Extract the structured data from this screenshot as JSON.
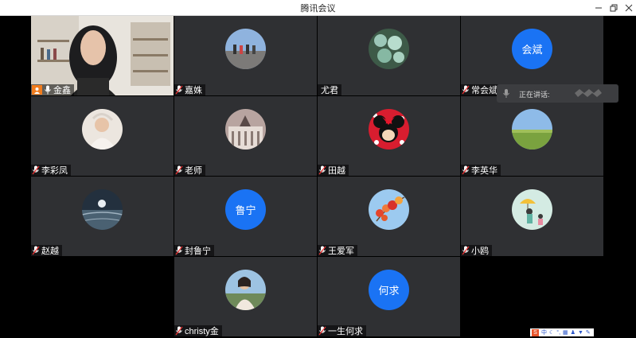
{
  "window": {
    "title": "腾讯会议",
    "minimize_icon": "minimize-icon",
    "restore_icon": "restore-icon",
    "close_icon": "close-icon"
  },
  "speaking": {
    "label": "正在讲话:"
  },
  "participants": [
    {
      "name": "金鑫",
      "avatar": "camera-video",
      "host": true
    },
    {
      "name": "嘉姝",
      "avatar": "photo-group-outdoor"
    },
    {
      "name": "尤君",
      "avatar": "photo-succulents"
    },
    {
      "name": "常会斌",
      "avatar_text": "会斌"
    },
    {
      "name": "李彩凤",
      "avatar": "photo-bride"
    },
    {
      "name": "老师",
      "avatar": "photo-building"
    },
    {
      "name": "田越",
      "avatar": "photo-minnie-mouse"
    },
    {
      "name": "李英华",
      "avatar": "photo-grassland"
    },
    {
      "name": "赵越",
      "avatar": "photo-moon-sea"
    },
    {
      "name": "封鲁宁",
      "avatar_text": "鲁宁"
    },
    {
      "name": "王爱军",
      "avatar": "photo-red-leaves"
    },
    {
      "name": "小鸥",
      "avatar": "photo-umbrella-illustration"
    },
    {
      "name": "christy金",
      "avatar": "photo-woman-cliff"
    },
    {
      "name": "一生何求",
      "avatar_text": "何求"
    }
  ],
  "tray": {
    "ime_label": "中"
  },
  "colors": {
    "tile_bg": "#2f3033",
    "text_avatar_bg": "#1a73f4",
    "host_badge": "#f07c1e"
  }
}
